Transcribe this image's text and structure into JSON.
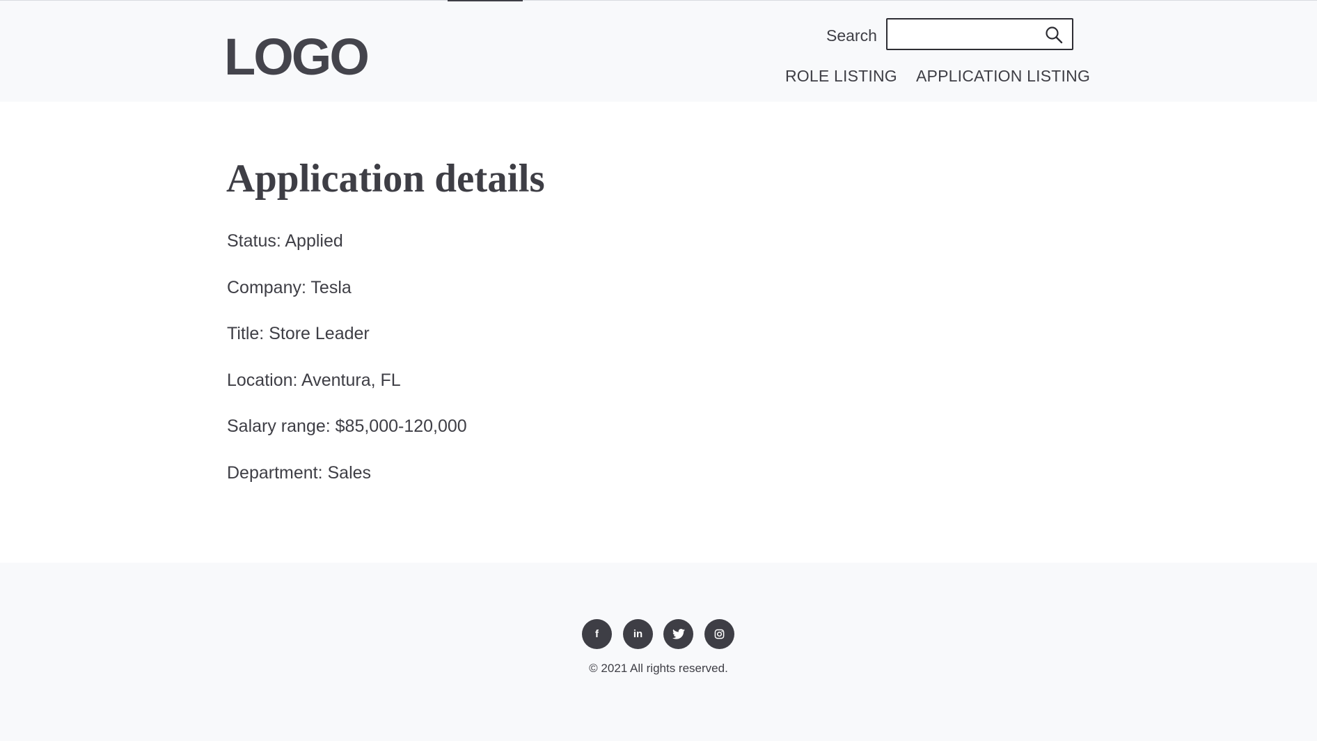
{
  "header": {
    "logo": "LOGO",
    "search": {
      "label": "Search",
      "value": "",
      "placeholder": ""
    },
    "nav": [
      {
        "label": "ROLE LISTING"
      },
      {
        "label": "APPLICATION LISTING"
      }
    ]
  },
  "main": {
    "title": "Application details",
    "details": [
      "Status: Applied",
      "Company: Tesla",
      "Title: Store Leader",
      "Location: Aventura, FL",
      "Salary range: $85,000-120,000",
      "Department: Sales"
    ]
  },
  "footer": {
    "social": [
      {
        "icon": "facebook-icon",
        "glyph": "f"
      },
      {
        "icon": "linkedin-icon",
        "glyph": "in"
      },
      {
        "icon": "twitter-icon",
        "glyph": ""
      },
      {
        "icon": "instagram-icon",
        "glyph": ""
      }
    ],
    "copyright": "© 2021 All rights reserved."
  },
  "colors": {
    "text": "#3e3e45",
    "header_bg": "#f8f9fb",
    "footer_bg": "#f8f9fb",
    "icon_bg": "#3e3e45"
  }
}
